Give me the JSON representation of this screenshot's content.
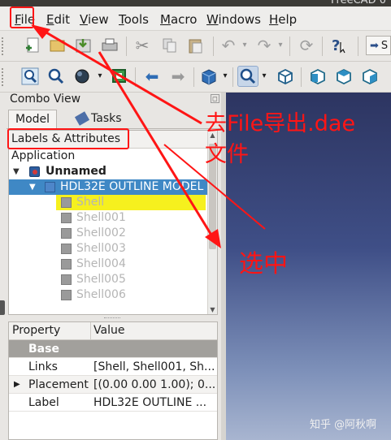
{
  "window": {
    "title": "FreeCAD 0"
  },
  "menubar": {
    "items": [
      {
        "label": "File",
        "underline": "F",
        "rest": "ile"
      },
      {
        "label": "Edit",
        "underline": "E",
        "rest": "dit"
      },
      {
        "label": "View",
        "underline": "V",
        "rest": "iew"
      },
      {
        "label": "Tools",
        "underline": "T",
        "rest": "ools"
      },
      {
        "label": "Macro",
        "underline": "M",
        "rest": "acro"
      },
      {
        "label": "Windows",
        "underline": "W",
        "rest": "indows"
      },
      {
        "label": "Help",
        "underline": "H",
        "rest": "elp"
      }
    ]
  },
  "toolbar1": {
    "icons": [
      "new-icon",
      "open-icon",
      "save-icon",
      "print-icon",
      "cut-icon",
      "copy-icon",
      "paste-icon",
      "undo-icon",
      "redo-icon",
      "refresh-icon",
      "whats-this-icon",
      "workbench-icon"
    ],
    "workbench_label": "S"
  },
  "toolbar2": {
    "icons": [
      "fit-all-icon",
      "fit-selection-icon",
      "draw-style-icon",
      "bounding-box-icon",
      "back-icon",
      "forward-icon",
      "std-views-icon",
      "zoom-icon",
      "isometric-icon",
      "front-icon",
      "top-icon",
      "right-icon"
    ]
  },
  "combo": {
    "title": "Combo View",
    "tabs": [
      {
        "label": "Model"
      },
      {
        "label": "Tasks"
      }
    ],
    "tree_header": "Labels & Attributes",
    "tree": [
      {
        "label": "Application",
        "level": 0
      },
      {
        "label": "Unnamed",
        "level": 1
      },
      {
        "label": "HDL32E OUTLINE MODEL",
        "level": 2
      },
      {
        "label": "Shell",
        "level": 3
      },
      {
        "label": "Shell001",
        "level": 3
      },
      {
        "label": "Shell002",
        "level": 3
      },
      {
        "label": "Shell003",
        "level": 3
      },
      {
        "label": "Shell004",
        "level": 3
      },
      {
        "label": "Shell005",
        "level": 3
      },
      {
        "label": "Shell006",
        "level": 3
      }
    ]
  },
  "properties": {
    "headers": {
      "property": "Property",
      "value": "Value"
    },
    "group": "Base",
    "rows": [
      {
        "key": "Links",
        "value": "[Shell, Shell001, Sh..."
      },
      {
        "key": "Placement",
        "value": "[(0.00 0.00 1.00); 0...."
      },
      {
        "key": "Label",
        "value": "HDL32E OUTLINE ..."
      }
    ]
  },
  "annotations": {
    "note1_line1": "去File导出.dae",
    "note1_line2": "文件",
    "note2": "选中",
    "color": "#ff1515"
  },
  "watermark": "知乎 @阿秋啊"
}
